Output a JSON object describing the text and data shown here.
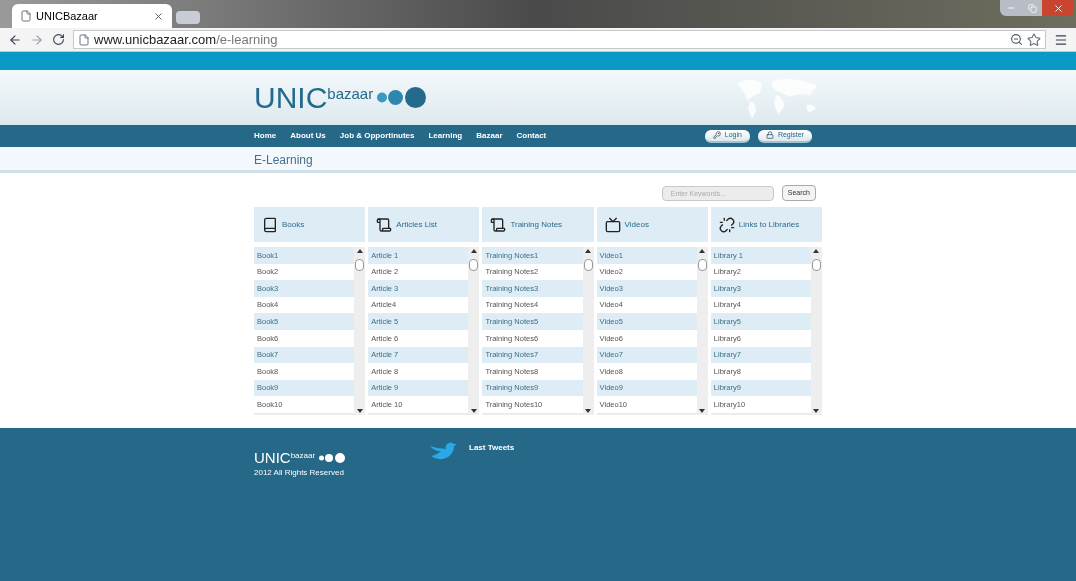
{
  "browser": {
    "tab_title": "UNICBazaar",
    "url_host": "www.unicbazaar.com",
    "url_path": "/e-learning"
  },
  "logo": {
    "main": "UNIC",
    "sub": "bazaar"
  },
  "nav": [
    "Home",
    "About Us",
    "Job & Opportinutes",
    "Learning",
    "Bazaar",
    "Contact"
  ],
  "account_buttons": [
    "Login",
    "Register"
  ],
  "page_title": "E-Learning",
  "search": {
    "placeholder": "Enter Keywords...",
    "button": "Search"
  },
  "columns": [
    {
      "title": "Books",
      "items": [
        "Book1",
        "Book2",
        "Book3",
        "Book4",
        "Book5",
        "Book6",
        "Book7",
        "Book8",
        "Book9",
        "Book10"
      ]
    },
    {
      "title": "Articles List",
      "items": [
        "Article 1",
        "Article 2",
        "Article 3",
        "Article4",
        "Article 5",
        "Article 6",
        "Article 7",
        "Article 8",
        "Article 9",
        "Article 10"
      ]
    },
    {
      "title": "Training Notes",
      "items": [
        "Training Notes1",
        "Training Notes2",
        "Training Notes3",
        "Training Notes4",
        "Training Notes5",
        "Training Notes6",
        "Training Notes7",
        "Training Notes8",
        "Training Notes9",
        "Training Notes10"
      ]
    },
    {
      "title": "Videos",
      "items": [
        "Video1",
        "Video2",
        "Video3",
        "Video4",
        "Video5",
        "Video6",
        "Video7",
        "Video8",
        "Video9",
        "Video10"
      ]
    },
    {
      "title": "Links to Libraries",
      "items": [
        "Library 1",
        "Library2",
        "Library3",
        "Library4",
        "Library5",
        "Library6",
        "Library7",
        "Library8",
        "Library9",
        "Library10"
      ]
    }
  ],
  "footer": {
    "logo": {
      "main": "UNIC",
      "sub": "bazaar"
    },
    "copyright": "2012 All Rights Reserved",
    "tweets_title": "Last Tweets"
  }
}
